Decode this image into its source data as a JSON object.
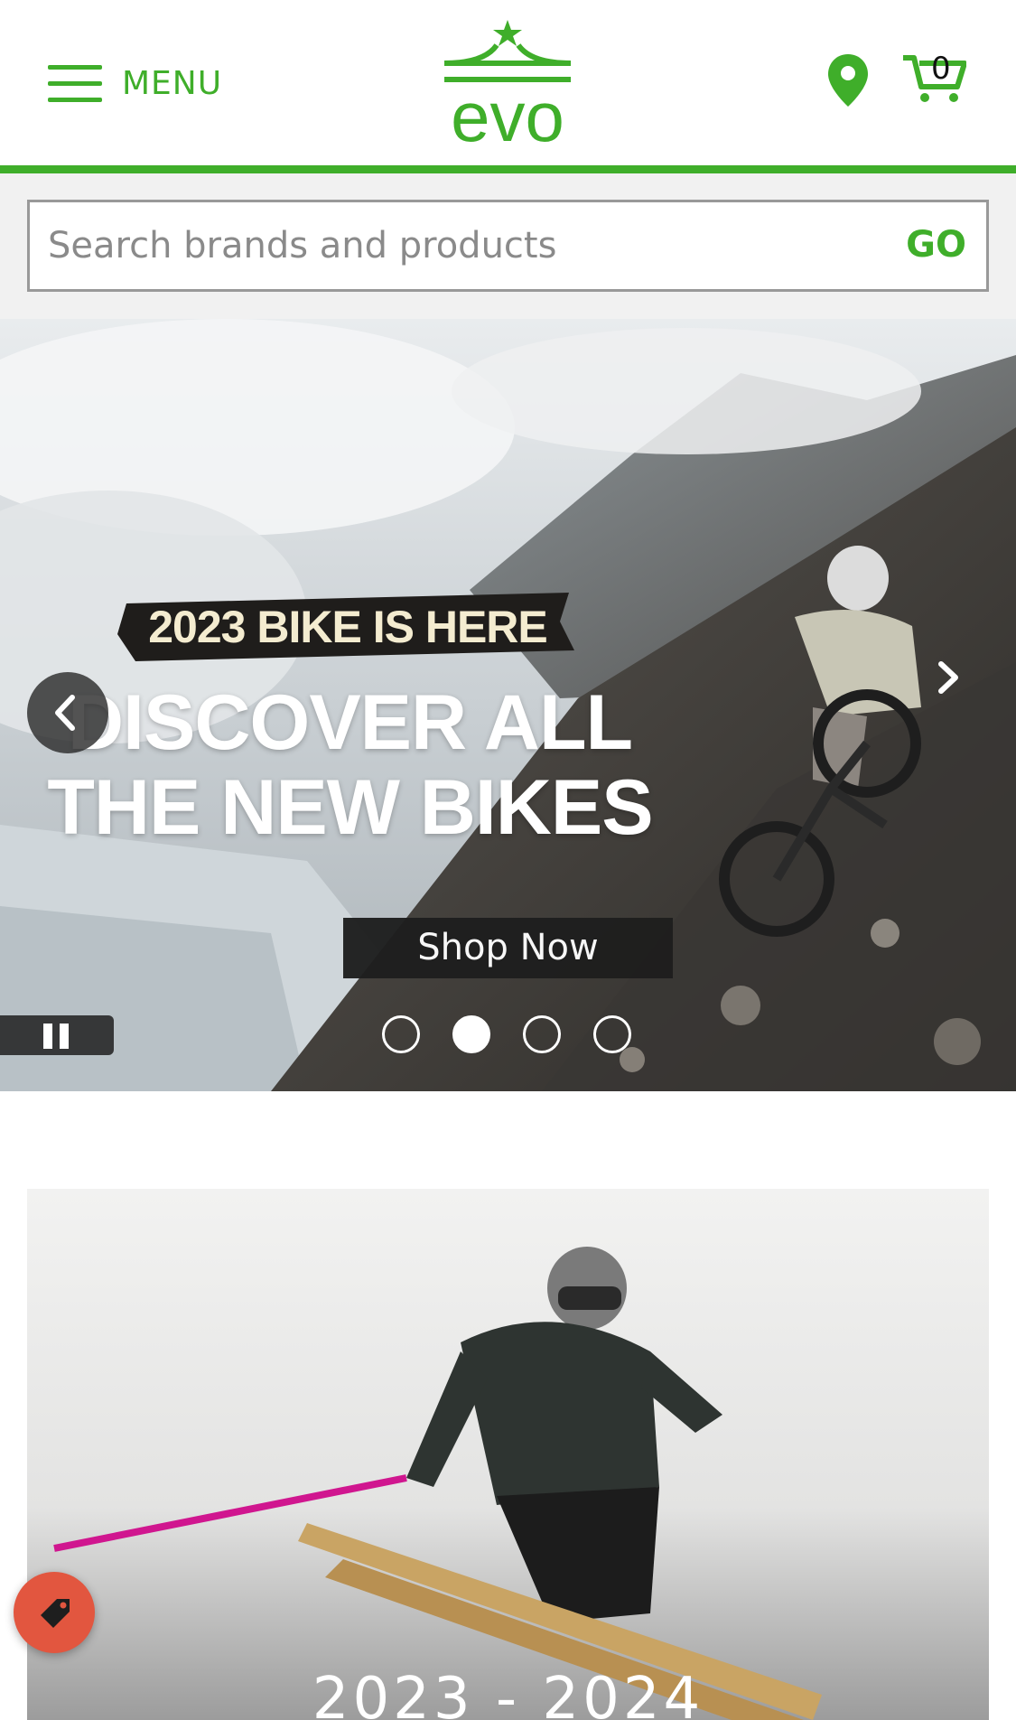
{
  "header": {
    "menu_label": "MENU",
    "logo_text": "evo",
    "cart_count": "0",
    "brand_color": "#3fae2a"
  },
  "search": {
    "placeholder": "Search brands and products",
    "go_label": "GO"
  },
  "hero": {
    "tag": "2023 BIKE IS HERE",
    "title_line1": "DISCOVER ALL",
    "title_line2": "THE NEW BIKES",
    "cta": "Shop Now",
    "slides_total": 4,
    "active_slide": 2
  },
  "promo": {
    "caption": "2023 - 2024"
  },
  "icons": [
    "hamburger-icon",
    "location-pin-icon",
    "cart-icon",
    "chevron-left-icon",
    "chevron-right-icon",
    "pause-icon",
    "tag-icon"
  ]
}
